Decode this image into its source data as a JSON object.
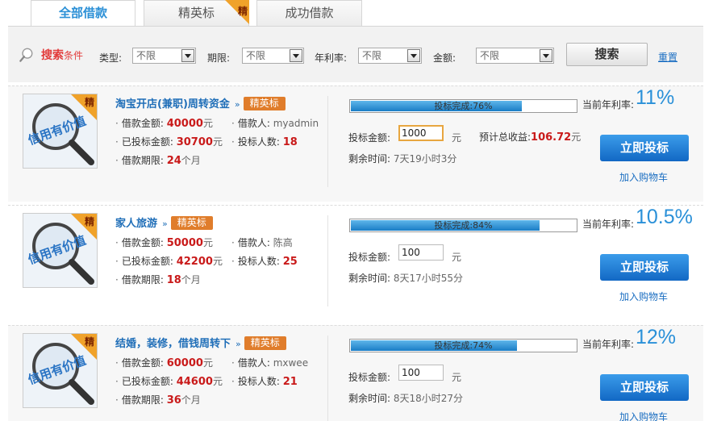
{
  "tabs": [
    {
      "label": "全部借款",
      "active": true
    },
    {
      "label": "精英标",
      "corner": "精"
    },
    {
      "label": "成功借款"
    }
  ],
  "search": {
    "title": "搜索",
    "title_suffix": "条件",
    "filters": [
      {
        "label": "类型:",
        "value": "不限"
      },
      {
        "label": "期限:",
        "value": "不限"
      },
      {
        "label": "年利率:",
        "value": "不限"
      },
      {
        "label": "金额:",
        "value": "不限"
      }
    ],
    "search_button": "搜索",
    "reset_link": "重置"
  },
  "card_labels": {
    "badge": "精",
    "thumb_text": "信用有价值",
    "amount_label": "借款金额:",
    "borrower_label": "借款人:",
    "invested_label": "已投标金额:",
    "investors_label": "投标人数:",
    "term_label": "借款期限:",
    "term_unit": "个月",
    "yuan": "元",
    "progress_prefix": "投标完成:",
    "bid_label": "投标金额:",
    "profit_label": "预计总收益:",
    "remain_label": "剩余时间:",
    "rate_label": "当前年利率:",
    "invest_button": "立即投标",
    "cart_link": "加入购物车"
  },
  "loans": [
    {
      "title": "淘宝开店(兼职)周转资金",
      "chevron": "»",
      "tag": "精英标",
      "amount": "40000",
      "borrower": "myadmin",
      "invested": "30700",
      "investors": "18",
      "term": "24",
      "progress": 76,
      "progress_text": "76%",
      "bid": "1000",
      "profit": "106.72",
      "remain": "7天19小时3分",
      "rate": "11%"
    },
    {
      "title": "家人旅游",
      "chevron": "»",
      "tag": "精英标",
      "amount": "50000",
      "borrower": "陈高",
      "invested": "42200",
      "investors": "25",
      "term": "18",
      "progress": 84,
      "progress_text": "84%",
      "bid": "100",
      "profit": "",
      "remain": "8天17小时55分",
      "rate": "10.5%"
    },
    {
      "title": "结婚，装修，借钱周转下",
      "chevron": "»",
      "tag": "精英标",
      "amount": "60000",
      "borrower": "mxwee",
      "invested": "44600",
      "investors": "21",
      "term": "36",
      "progress": 74,
      "progress_text": "74%",
      "bid": "100",
      "profit": "",
      "remain": "8天18小时27分",
      "rate": "12%"
    }
  ]
}
